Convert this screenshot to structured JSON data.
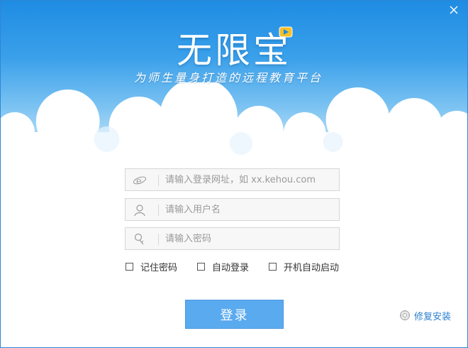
{
  "app": {
    "title": "无限宝",
    "slogan": "为师生量身打造的远程教育平台"
  },
  "form": {
    "server": {
      "placeholder": "请输入登录网址，如 xx.kehou.com",
      "value": ""
    },
    "username": {
      "placeholder": "请输入用户名",
      "value": ""
    },
    "password": {
      "placeholder": "请输入密码",
      "value": ""
    }
  },
  "options": [
    {
      "label": "记住密码",
      "checked": false
    },
    {
      "label": "自动登录",
      "checked": false
    },
    {
      "label": "开机自动启动",
      "checked": false
    }
  ],
  "buttons": {
    "login_label": "登录",
    "repair_label": "修复安装"
  },
  "icons": {
    "close": "close-icon",
    "server": "ie-icon",
    "user": "user-icon",
    "password": "key-icon",
    "repair": "gear-icon"
  },
  "colors": {
    "sky_top": "#1f8ce3",
    "accent": "#5aaaf0",
    "link": "#2a7fd0"
  }
}
